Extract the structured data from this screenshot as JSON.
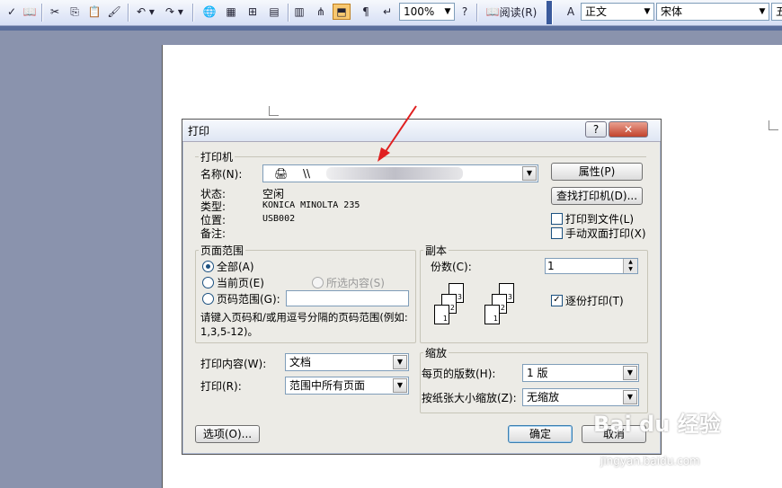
{
  "toolbar": {
    "zoom": "100%",
    "reading_label": "阅读(R)",
    "style_value": "正文",
    "font_value": "宋体",
    "size_value": "五"
  },
  "dialog": {
    "title": "打印",
    "help_label": "?",
    "close_label": "✕",
    "printer": {
      "group_title": "打印机",
      "name_label": "名称(N):",
      "name_value_prefix": "\\\\",
      "status_label": "状态:",
      "status_value": "空闲",
      "type_label": "类型:",
      "type_value": "KONICA MINOLTA 235",
      "location_label": "位置:",
      "location_value": "USB002",
      "comment_label": "备注:",
      "properties_button": "属性(P)",
      "find_printer_button": "查找打印机(D)...",
      "print_to_file_label": "打印到文件(L)",
      "print_to_file_checked": false,
      "manual_duplex_label": "手动双面打印(X)",
      "manual_duplex_checked": false
    },
    "page_range": {
      "group_title": "页面范围",
      "all_label": "全部(A)",
      "all_selected": true,
      "current_page_label": "当前页(E)",
      "selection_label": "所选内容(S)",
      "pages_label": "页码范围(G):",
      "pages_value": "",
      "hint": "请键入页码和/或用逗号分隔的页码范围(例如: 1,3,5-12)。"
    },
    "copies": {
      "group_title": "副本",
      "count_label": "份数(C):",
      "count_value": "1",
      "collate_label": "逐份打印(T)",
      "collate_checked": true,
      "sheet_numbers": [
        "3",
        "2",
        "1"
      ]
    },
    "print_what": {
      "label": "打印内容(W):",
      "value": "文档"
    },
    "print_range": {
      "label": "打印(R):",
      "value": "范围中所有页面"
    },
    "zoom": {
      "group_title": "缩放",
      "pages_per_sheet_label": "每页的版数(H):",
      "pages_per_sheet_value": "1 版",
      "scale_label": "按纸张大小缩放(Z):",
      "scale_value": "无缩放"
    },
    "options_button": "选项(O)...",
    "ok_button": "确定",
    "cancel_button": "取消"
  },
  "watermark": {
    "brand": "Bai du 经验",
    "url": "jingyan.baidu.com"
  },
  "colors": {
    "workspace": "#8a93ad",
    "dialog_bg": "#ecebe6",
    "arrow": "#e02020",
    "close_red": "#c2432c"
  },
  "icons": [
    "spell-check-icon",
    "research-icon",
    "cut-icon",
    "copy-icon",
    "paste-icon",
    "format-painter-icon",
    "undo-icon",
    "redo-icon",
    "hyperlink-icon",
    "tables-borders-icon",
    "insert-table-icon",
    "insert-excel-icon",
    "columns-icon",
    "drawing-icon",
    "document-map-icon",
    "show-hide-icon",
    "help-icon",
    "read-icon",
    "styles-icon",
    "printer-icon"
  ]
}
